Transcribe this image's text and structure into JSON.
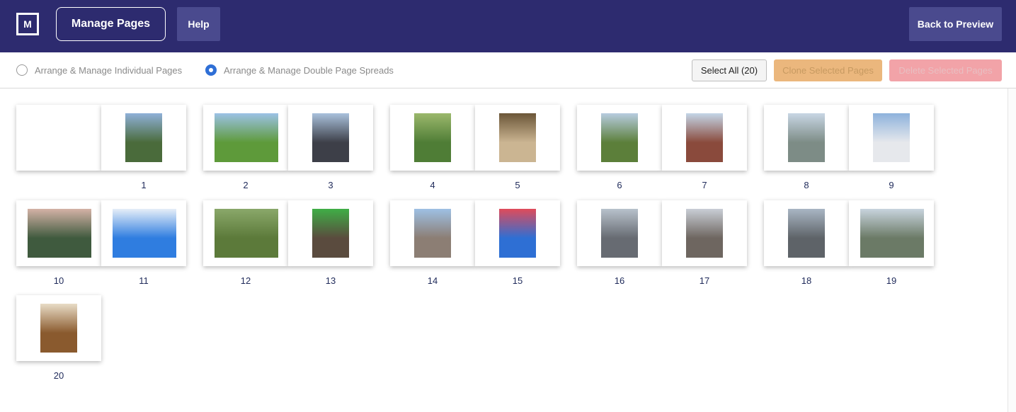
{
  "header": {
    "logo_text": "M",
    "manage_pages_label": "Manage Pages",
    "help_label": "Help",
    "back_label": "Back to Preview"
  },
  "toolbar": {
    "radio_individual_label": "Arrange & Manage Individual Pages",
    "radio_spreads_label": "Arrange & Manage Double Page Spreads",
    "selected_mode": "spreads",
    "select_all_label": "Select All (20)",
    "clone_label": "Clone Selected Pages",
    "delete_label": "Delete Selected Pages"
  },
  "pages": [
    {
      "label": "1"
    },
    {
      "label": "2"
    },
    {
      "label": "3"
    },
    {
      "label": "4"
    },
    {
      "label": "5"
    },
    {
      "label": "6"
    },
    {
      "label": "7"
    },
    {
      "label": "8"
    },
    {
      "label": "9"
    },
    {
      "label": "10"
    },
    {
      "label": "11"
    },
    {
      "label": "12"
    },
    {
      "label": "13"
    },
    {
      "label": "14"
    },
    {
      "label": "15"
    },
    {
      "label": "16"
    },
    {
      "label": "17"
    },
    {
      "label": "18"
    },
    {
      "label": "19"
    },
    {
      "label": "20"
    }
  ],
  "colors": {
    "header_bg": "#2d2b6f",
    "radio_selected": "#2f6fd6",
    "clone_bg": "#ebb77d",
    "delete_bg": "#f2a3a8"
  }
}
